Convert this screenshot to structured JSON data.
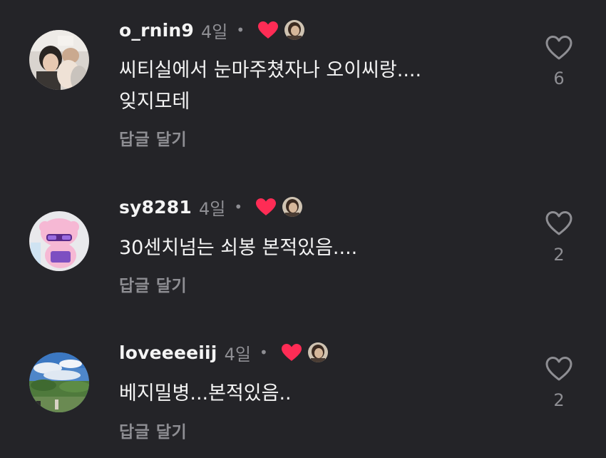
{
  "colors": {
    "background": "#242428",
    "text_primary": "#f4f4f4",
    "text_secondary": "#8e8e93",
    "liked_heart": "#fe2c55"
  },
  "comments": [
    {
      "username": "o_rnin9",
      "time": "4일",
      "separator": "•",
      "creator_liked": true,
      "text": "씨티실에서 눈마주쳤자나 오이씨랑....\n잊지모테",
      "reply_label": "답글 달기",
      "like_icon": "heart-outline-icon",
      "like_count": "6"
    },
    {
      "username": "sy8281",
      "time": "4일",
      "separator": "•",
      "creator_liked": true,
      "text": "30센치넘는 쇠봉 본적있음....",
      "reply_label": "답글 달기",
      "like_icon": "heart-outline-icon",
      "like_count": "2"
    },
    {
      "username": "loveeeeiij",
      "time": "4일",
      "separator": "•",
      "creator_liked": true,
      "text": "베지밀병...본적있음..",
      "reply_label": "답글 달기",
      "like_icon": "heart-outline-icon",
      "like_count": "2"
    }
  ]
}
